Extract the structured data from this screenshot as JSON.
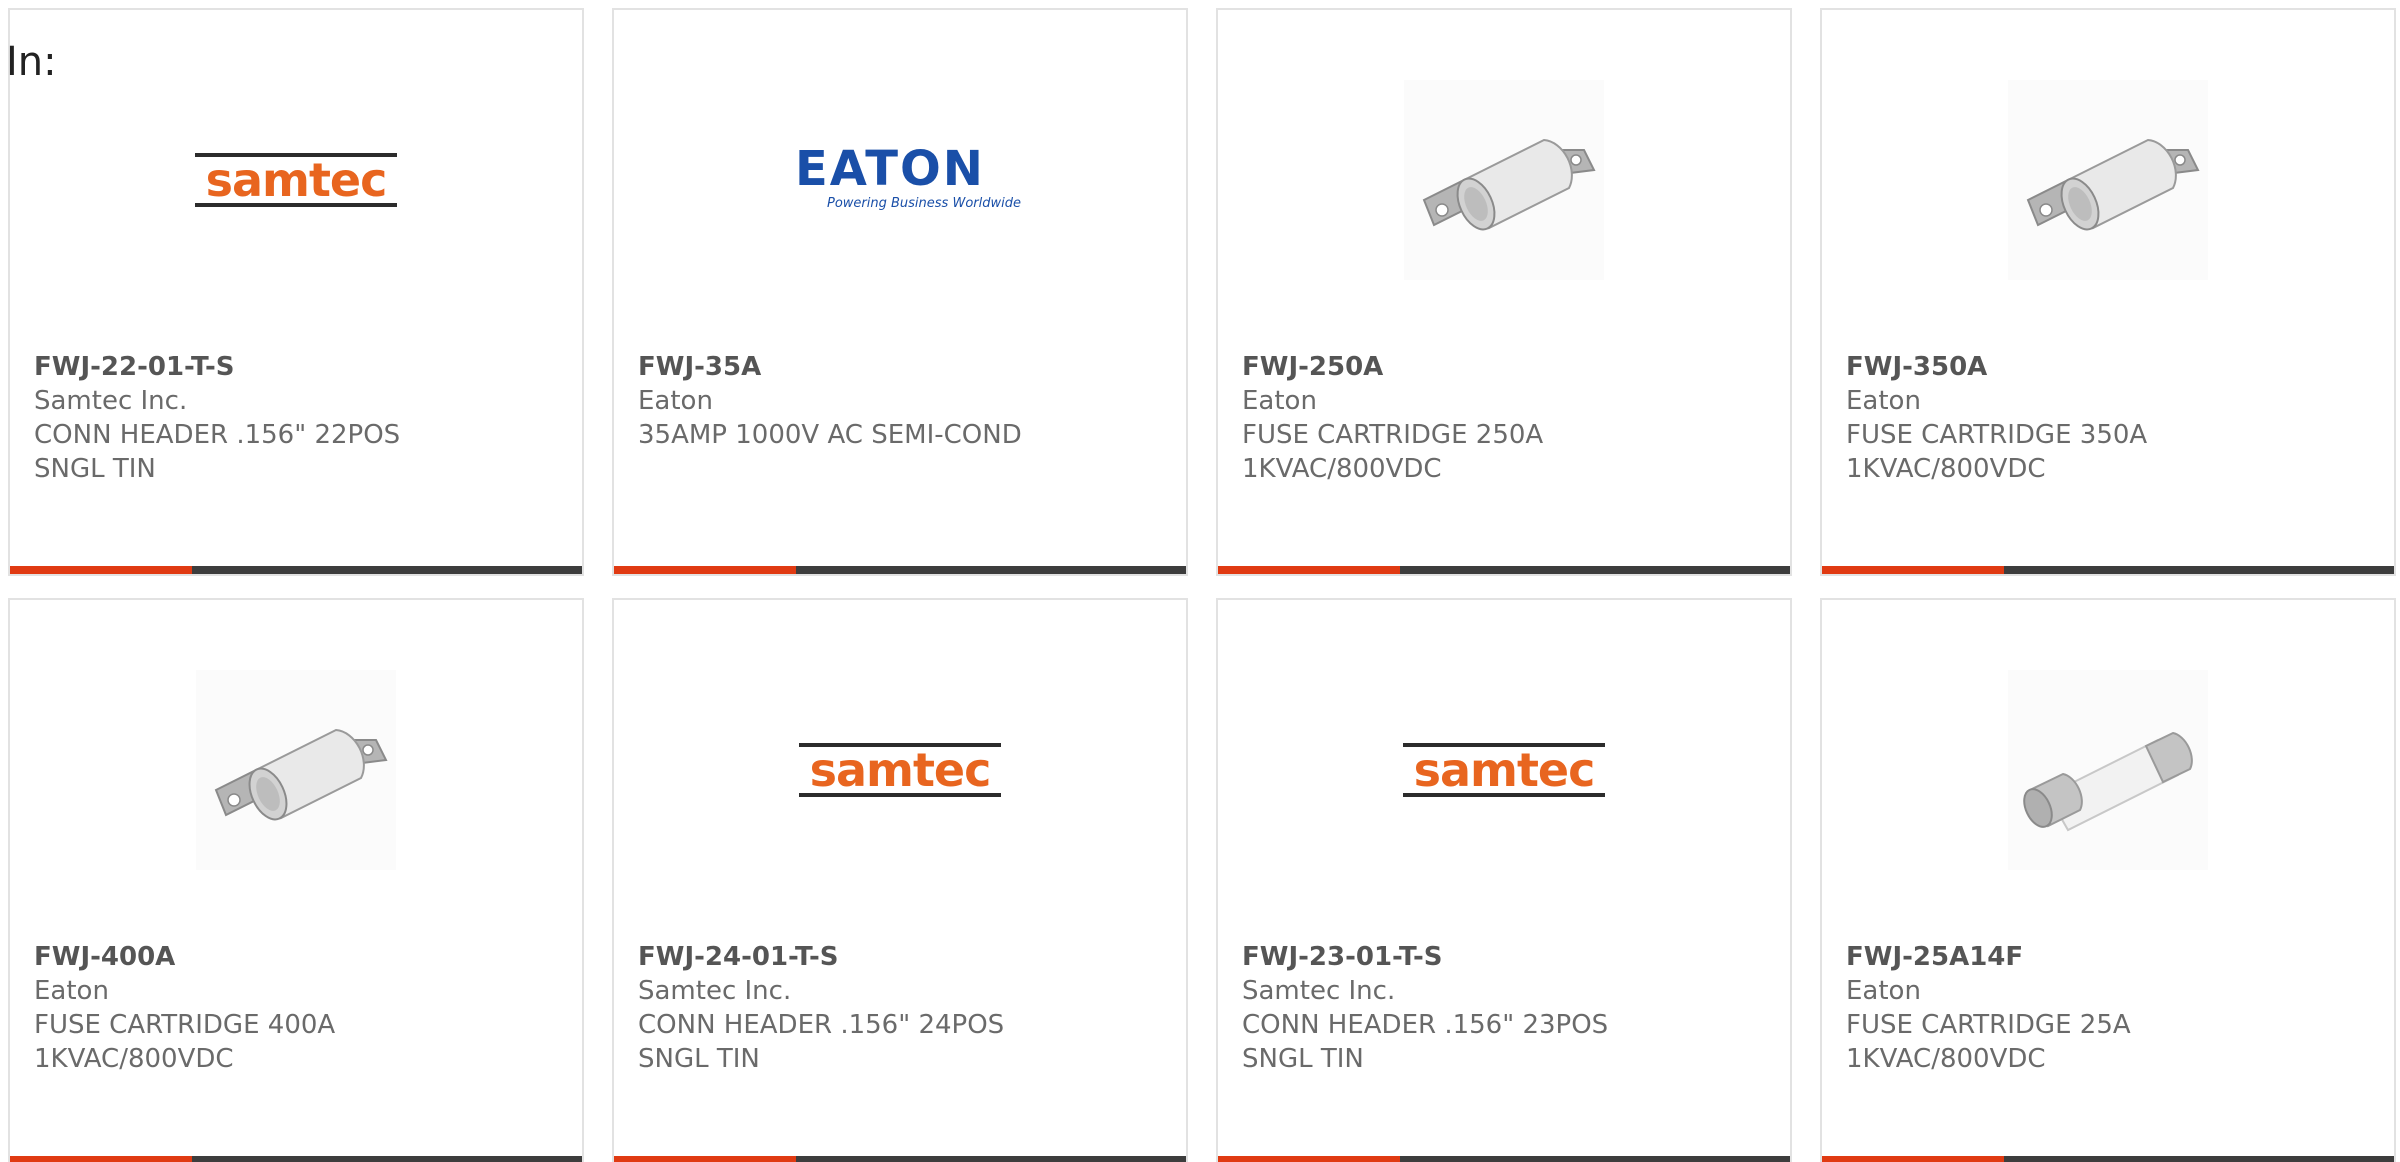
{
  "header": {
    "in_label": "In:"
  },
  "colors": {
    "accent": "#e03a12",
    "bar": "#3d3d3d",
    "samtec_orange": "#e8651f",
    "eaton_blue": "#1a4fa8"
  },
  "logos": {
    "samtec_text": "samtec",
    "eaton_text": "EATON",
    "eaton_tagline": "Powering Business Worldwide"
  },
  "products": [
    {
      "part": "FWJ-22-01-T-S",
      "maker": "Samtec Inc.",
      "desc_line1": "CONN HEADER .156\" 22POS",
      "desc_line2": "SNGL TIN",
      "image": "samtec-logo"
    },
    {
      "part": "FWJ-35A",
      "maker": "Eaton",
      "desc_line1": "35AMP 1000V AC SEMI-COND",
      "desc_line2": "",
      "image": "eaton-logo"
    },
    {
      "part": "FWJ-250A",
      "maker": "Eaton",
      "desc_line1": "FUSE CARTRIDGE 250A",
      "desc_line2": "1KVAC/800VDC",
      "image": "fuse-cartridge-bolt"
    },
    {
      "part": "FWJ-350A",
      "maker": "Eaton",
      "desc_line1": "FUSE CARTRIDGE 350A",
      "desc_line2": "1KVAC/800VDC",
      "image": "fuse-cartridge-bolt"
    },
    {
      "part": "FWJ-400A",
      "maker": "Eaton",
      "desc_line1": "FUSE CARTRIDGE 400A",
      "desc_line2": "1KVAC/800VDC",
      "image": "fuse-cartridge-bolt"
    },
    {
      "part": "FWJ-24-01-T-S",
      "maker": "Samtec Inc.",
      "desc_line1": "CONN HEADER .156\" 24POS",
      "desc_line2": "SNGL TIN",
      "image": "samtec-logo"
    },
    {
      "part": "FWJ-23-01-T-S",
      "maker": "Samtec Inc.",
      "desc_line1": "CONN HEADER .156\" 23POS",
      "desc_line2": "SNGL TIN",
      "image": "samtec-logo"
    },
    {
      "part": "FWJ-25A14F",
      "maker": "Eaton",
      "desc_line1": "FUSE CARTRIDGE 25A",
      "desc_line2": "1KVAC/800VDC",
      "image": "fuse-glass-tube"
    }
  ]
}
